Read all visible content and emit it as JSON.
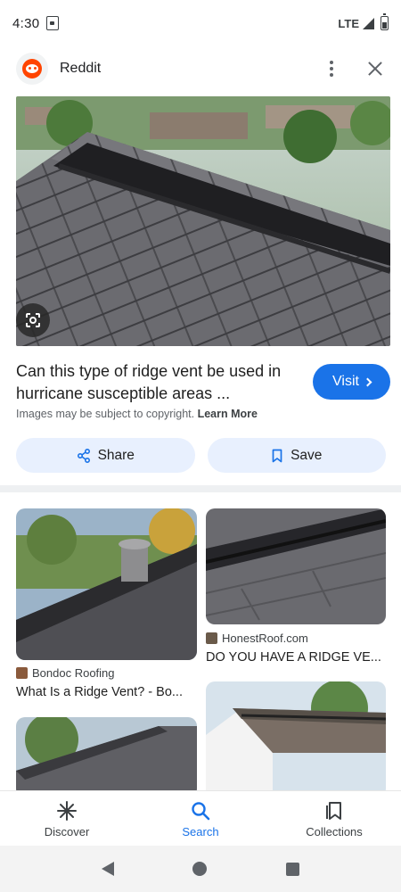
{
  "status_bar": {
    "time": "4:30",
    "network": "LTE"
  },
  "header": {
    "site_name": "Reddit"
  },
  "result": {
    "title": "Can this type of ridge vent be used in hurricane susceptible areas ...",
    "visit_label": "Visit",
    "copyright_text": "Images may be subject to copyright.",
    "learn_more_label": "Learn More"
  },
  "actions": {
    "share_label": "Share",
    "save_label": "Save"
  },
  "related": [
    {
      "source": "Bondoc Roofing",
      "title": "What Is a Ridge Vent? - Bo..."
    },
    {
      "source": "HonestRoof.com",
      "title": "DO YOU HAVE A RIDGE VE..."
    }
  ],
  "bottom_nav": [
    {
      "label": "Discover"
    },
    {
      "label": "Search"
    },
    {
      "label": "Collections"
    }
  ],
  "colors": {
    "accent": "#1a73e8",
    "pill_bg": "#e8f0fe",
    "reddit": "#ff4500"
  },
  "icons": [
    "phone-status-icon",
    "signal-icon",
    "battery-icon",
    "reddit-logo-icon",
    "more-vert-icon",
    "close-icon",
    "google-lens-icon",
    "chevron-right-icon",
    "share-icon",
    "bookmark-icon",
    "discover-icon",
    "search-icon",
    "collections-icon"
  ]
}
